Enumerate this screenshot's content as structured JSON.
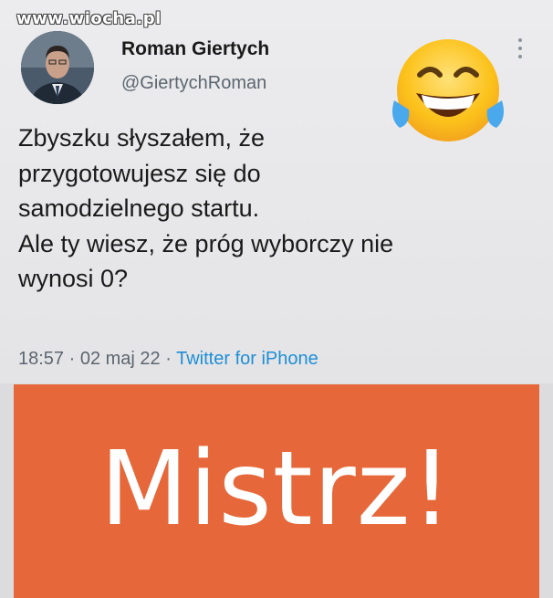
{
  "watermark": "www.wiocha.pl",
  "tweet": {
    "author_name": "Roman Giertych",
    "author_handle": "@GiertychRoman",
    "avatar_icon": "profile-photo",
    "menu_icon": "more-options-icon",
    "emoji": "face-with-tears-of-joy",
    "text_lines": [
      "Zbyszku słyszałem, że",
      "przygotowujesz się do",
      "samodzielnego startu.",
      "Ale ty wiesz, że próg wyborczy nie",
      "wynosi 0?"
    ],
    "time": "18:57",
    "separator": " · ",
    "date": "02 maj 22",
    "source": "Twitter for iPhone"
  },
  "banner": {
    "text": "Mistrz!",
    "background_color": "#e6683a"
  }
}
